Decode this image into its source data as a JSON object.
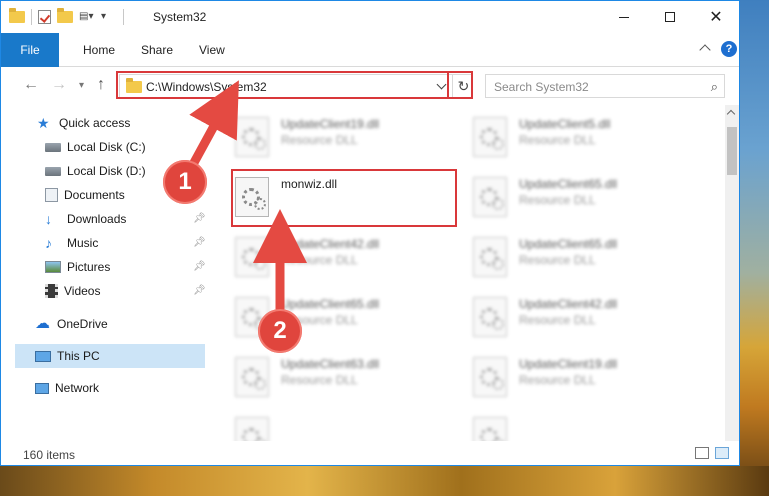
{
  "window": {
    "title": "System32"
  },
  "ribbon": {
    "tabs": [
      "File",
      "Home",
      "Share",
      "View"
    ]
  },
  "nav": {
    "address": "C:\\Windows\\System32",
    "search_placeholder": "Search System32"
  },
  "sidebar": {
    "items": [
      {
        "label": "Quick access",
        "icon": "star-icon",
        "pinned": false
      },
      {
        "label": "Local Disk (C:)",
        "icon": "drive-icon",
        "pinned": false
      },
      {
        "label": "Local Disk (D:)",
        "icon": "drive-icon",
        "pinned": false
      },
      {
        "label": "Documents",
        "icon": "documents-icon",
        "pinned": true
      },
      {
        "label": "Downloads",
        "icon": "download-icon",
        "pinned": true
      },
      {
        "label": "Music",
        "icon": "music-icon",
        "pinned": true
      },
      {
        "label": "Pictures",
        "icon": "pictures-icon",
        "pinned": true
      },
      {
        "label": "Videos",
        "icon": "videos-icon",
        "pinned": true
      },
      {
        "label": "OneDrive",
        "icon": "cloud-icon",
        "pinned": false
      },
      {
        "label": "This PC",
        "icon": "computer-icon",
        "pinned": false,
        "selected": true
      },
      {
        "label": "Network",
        "icon": "network-icon",
        "pinned": false
      }
    ]
  },
  "files": [
    {
      "name": "UpdateClient19.dll",
      "type": "Resource DLL"
    },
    {
      "name": "UpdateClient5.dll",
      "type": "Resource DLL"
    },
    {
      "name": "monwiz.dll",
      "type": ""
    },
    {
      "name": "UpdateClient65.dll",
      "type": "Resource DLL"
    },
    {
      "name": "UpdateClient42.dll",
      "type": "Resource DLL"
    },
    {
      "name": "UpdateClient65.dll",
      "type": "Resource DLL"
    },
    {
      "name": "UpdateClient65.dll",
      "type": "Resource DLL"
    },
    {
      "name": "UpdateClient42.dll",
      "type": "Resource DLL"
    },
    {
      "name": "UpdateClient63.dll",
      "type": "Resource DLL"
    },
    {
      "name": "UpdateClient19.dll",
      "type": "Resource DLL"
    }
  ],
  "status": {
    "item_count": "160 items"
  },
  "annotations": {
    "step1": "1",
    "step2": "2"
  },
  "colors": {
    "accent": "#1979ca",
    "highlight": "#d9383a",
    "selected_bg": "#cce4f7"
  }
}
